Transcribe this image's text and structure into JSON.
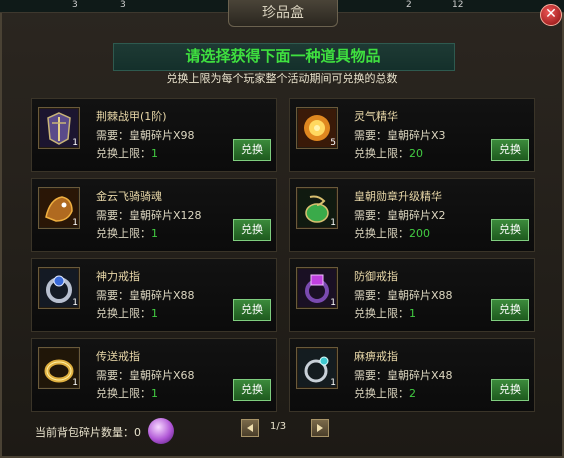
{
  "window": {
    "title": "珍品盒",
    "top_counts": [
      "3",
      "3",
      "2",
      "12"
    ]
  },
  "banner": {
    "title": "请选择获得下面一种道具物品",
    "subtitle": "兑换上限为每个玩家整个活动期间可兑换的总数"
  },
  "items": [
    {
      "name": "荆棘战甲(1阶)",
      "cost": "需要：皇朝碎片X98",
      "limit_label": "兑换上限：",
      "limit": "1",
      "count": "1",
      "button": "兑换",
      "icon": "armor-icon"
    },
    {
      "name": "灵气精华",
      "cost": "需要：皇朝碎片X3",
      "limit_label": "兑换上限：",
      "limit": "20",
      "count": "5",
      "button": "兑换",
      "icon": "essence-icon"
    },
    {
      "name": "金云飞骑骑魂",
      "cost": "需要：皇朝碎片X128",
      "limit_label": "兑换上限：",
      "limit": "1",
      "count": "1",
      "button": "兑换",
      "icon": "mount-soul-icon"
    },
    {
      "name": "皇朝勋章升级精华",
      "cost": "需要：皇朝碎片X2",
      "limit_label": "兑换上限：",
      "limit": "200",
      "count": "1",
      "button": "兑换",
      "icon": "medal-essence-icon"
    },
    {
      "name": "神力戒指",
      "cost": "需要：皇朝碎片X88",
      "limit_label": "兑换上限：",
      "limit": "1",
      "count": "1",
      "button": "兑换",
      "icon": "ring-blue-icon"
    },
    {
      "name": "防御戒指",
      "cost": "需要：皇朝碎片X88",
      "limit_label": "兑换上限：",
      "limit": "1",
      "count": "1",
      "button": "兑换",
      "icon": "ring-purple-icon"
    },
    {
      "name": "传送戒指",
      "cost": "需要：皇朝碎片X68",
      "limit_label": "兑换上限：",
      "limit": "1",
      "count": "1",
      "button": "兑换",
      "icon": "ring-gold-icon"
    },
    {
      "name": "麻痹戒指",
      "cost": "需要：皇朝碎片X48",
      "limit_label": "兑换上限：",
      "limit": "2",
      "count": "1",
      "button": "兑换",
      "icon": "ring-silver-icon"
    }
  ],
  "footer": {
    "fragments_label": "当前背包碎片数量：0",
    "page": "1/3"
  }
}
